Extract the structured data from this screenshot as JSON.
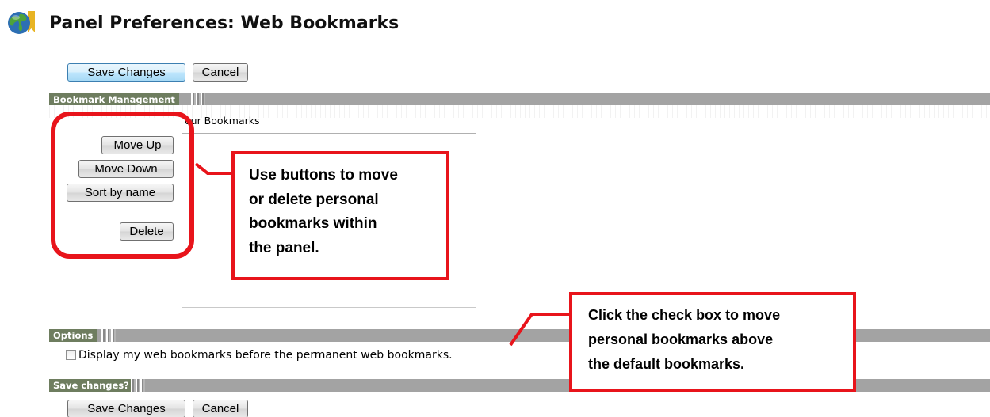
{
  "header": {
    "title": "Panel Preferences: Web Bookmarks"
  },
  "toolbar_top": {
    "save_label": "Save Changes",
    "cancel_label": "Cancel"
  },
  "bookmark_management": {
    "section_label": "Bookmark Management",
    "list_heading": "our Bookmarks",
    "buttons": {
      "move_up": "Move Up",
      "move_down": "Move Down",
      "sort_by_name": "Sort by name",
      "delete": "Delete"
    }
  },
  "options": {
    "section_label": "Options",
    "checkbox_checked": false,
    "checkbox_label": "Display my web bookmarks before the permanent web bookmarks."
  },
  "save_section": {
    "section_label": "Save changes?",
    "save_label": "Save Changes",
    "cancel_label": "Cancel"
  },
  "annotations": {
    "buttons_callout": {
      "lines": [
        "Use buttons to move",
        "or delete personal",
        "bookmarks within",
        "the panel."
      ]
    },
    "checkbox_callout": {
      "lines": [
        "Click the check box to move",
        "personal bookmarks above",
        "the default bookmarks."
      ]
    }
  },
  "colors": {
    "annotation_red": "#e8141b",
    "section_label_bg": "#6e7d5f",
    "section_bar_bg": "#a3a3a3",
    "primary_button_border": "#3c7fb1"
  },
  "icons": {
    "app_icon": "globe-bookmark-icon"
  }
}
